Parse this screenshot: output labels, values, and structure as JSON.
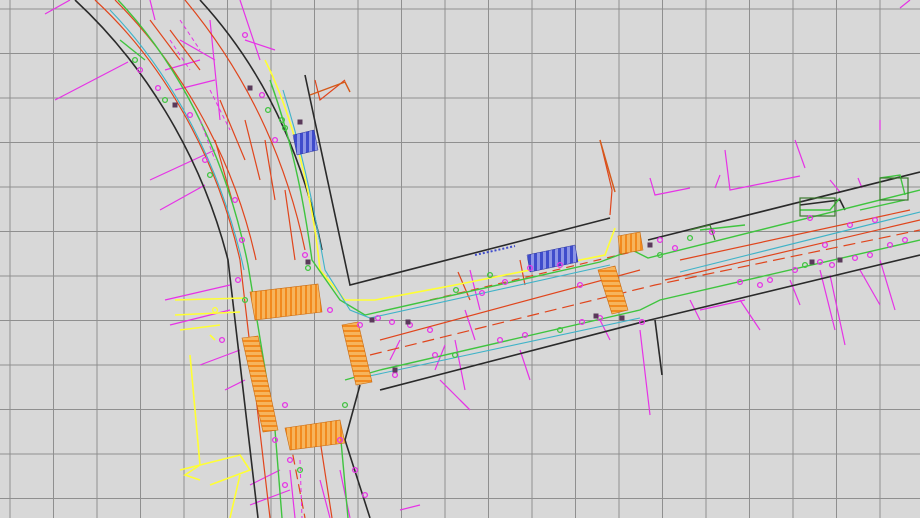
{
  "canvas": {
    "background": "#d8d8d8",
    "grid_visible": true,
    "grid_color": "#8f8f8f"
  },
  "layers": {
    "kerb": "#2a2a2a",
    "carriageway_marking": "#e0451c",
    "footway_edge": "#ffff33",
    "utility_green": "#3fc43f",
    "utility_cyan": "#3fb3c8",
    "annotation_magenta": "#e633e6",
    "crossing_hatch": "#f28a1e",
    "bus_stop_shelter": "#3f4ccc",
    "trench_orange": "#d45a1a"
  },
  "icons": {
    "street_furniture": "circle-marker-icon",
    "crossing": "hatched-crossing-icon",
    "shelter": "bus-shelter-icon"
  }
}
